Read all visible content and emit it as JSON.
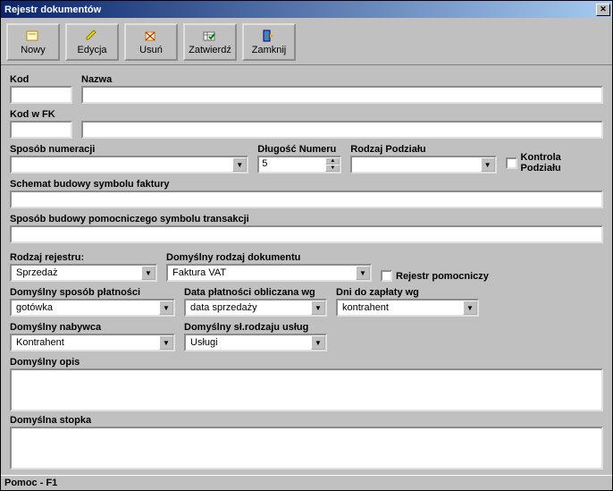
{
  "title": "Rejestr dokumentów",
  "toolbar": {
    "nowy": "Nowy",
    "edycja": "Edycja",
    "usun": "Usuń",
    "zatwierdz": "Zatwierdź",
    "zamknij": "Zamknij"
  },
  "labels": {
    "kod": "Kod",
    "nazwa": "Nazwa",
    "kod_fk": "Kod w FK",
    "sposob_numeracji": "Sposób numeracji",
    "dlugosc_numeru": "Długość Numeru",
    "rodzaj_podzialu": "Rodzaj Podziału",
    "kontrola_podzialu": "Kontrola Podziału",
    "schemat_symbolu": "Schemat budowy symbolu faktury",
    "sposob_symbolu_trans": "Sposób budowy pomocniczego symbolu transakcji",
    "rodzaj_rejestru": "Rodzaj rejestru:",
    "domyslny_rodzaj_dok": "Domyślny rodzaj dokumentu",
    "rejestr_pomocniczy": "Rejestr pomocniczy",
    "domyslny_sposob_plat": "Domyślny sposób płatności",
    "data_platnosci": "Data płatności obliczana wg",
    "dni_do_zaplaty": "Dni do zapłaty wg",
    "domyslny_nabywca": "Domyślny nabywca",
    "domyslny_sl_rodzaju": "Domyślny sł.rodzaju usług",
    "domyslny_opis": "Domyślny opis",
    "domyslna_stopka": "Domyślna stopka"
  },
  "values": {
    "kod": "",
    "nazwa": "",
    "kod_fk": "",
    "kod_fk_opis": "",
    "sposob_numeracji": "",
    "dlugosc_numeru": "5",
    "rodzaj_podzialu": "",
    "schemat_symbolu": "",
    "sposob_symbolu_trans": "",
    "rodzaj_rejestru": "Sprzedaż",
    "domyslny_rodzaj_dok": "Faktura VAT",
    "domyslny_sposob_plat": "gotówka",
    "data_platnosci": "data sprzedaży",
    "dni_do_zaplaty": "kontrahent",
    "domyslny_nabywca": "Kontrahent",
    "domyslny_sl_rodzaju": "Usługi",
    "domyslny_opis": "",
    "domyslna_stopka": ""
  },
  "footer": "Pomoc - F1"
}
